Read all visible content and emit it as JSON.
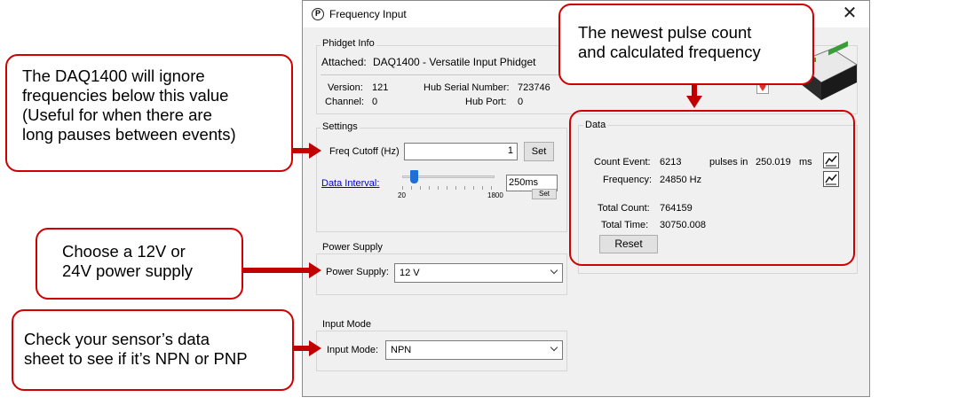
{
  "window": {
    "title": "Frequency Input",
    "app_icon_glyph": "P",
    "close_glyph": "✕"
  },
  "phidget_info": {
    "legend": "Phidget Info",
    "attached_label": "Attached:",
    "attached_value": "DAQ1400 - Versatile Input Phidget",
    "version_label": "Version:",
    "version_value": "121",
    "channel_label": "Channel:",
    "channel_value": "0",
    "hub_serial_label": "Hub Serial Number:",
    "hub_serial_value": "723746",
    "hub_port_label": "Hub Port:",
    "hub_port_value": "0"
  },
  "settings": {
    "legend": "Settings",
    "freq_cutoff_label": "Freq Cutoff (Hz)",
    "freq_cutoff_value": "1",
    "set_label": "Set",
    "data_interval_label": "Data Interval:",
    "slider_min": "20",
    "slider_max": "1800",
    "slider_level": 0.13,
    "interval_value": "250ms",
    "interval_set_label": "Set"
  },
  "power_supply": {
    "legend": "Power Supply",
    "label": "Power Supply:",
    "selected": "12 V"
  },
  "input_mode": {
    "legend": "Input Mode",
    "label": "Input Mode:",
    "selected": "NPN"
  },
  "data": {
    "legend": "Data",
    "count_event_label": "Count Event:",
    "count_event_value": "6213",
    "pulses_in_label": "pulses in",
    "pulses_in_value": "250.019",
    "ms_label": "ms",
    "frequency_label": "Frequency:",
    "frequency_value": "24850 Hz",
    "total_count_label": "Total Count:",
    "total_count_value": "764159",
    "total_time_label": "Total Time:",
    "total_time_value": "30750.008",
    "reset_label": "Reset"
  },
  "callouts": {
    "freq_cutoff_lines": [
      "The DAQ1400 will ignore",
      "frequencies below this value",
      "(Useful for when there are",
      "long pauses between events)"
    ],
    "data_lines": [
      "The newest pulse count",
      "and calculated frequency"
    ],
    "power_lines": [
      "Choose a 12V or",
      "24V power supply"
    ],
    "input_mode_lines": [
      "Check your sensor’s data",
      "sheet to see if it’s NPN or PNP"
    ]
  },
  "colors": {
    "callout_border": "#d10000",
    "arrow": "#c00000",
    "link": "#0000cc",
    "slider_thumb": "#1f6fd6"
  },
  "icons": {
    "graph_icon": "line-chart-icon",
    "device_image": "daq1400-device-icon",
    "location_icon": "location-pin-icon"
  }
}
